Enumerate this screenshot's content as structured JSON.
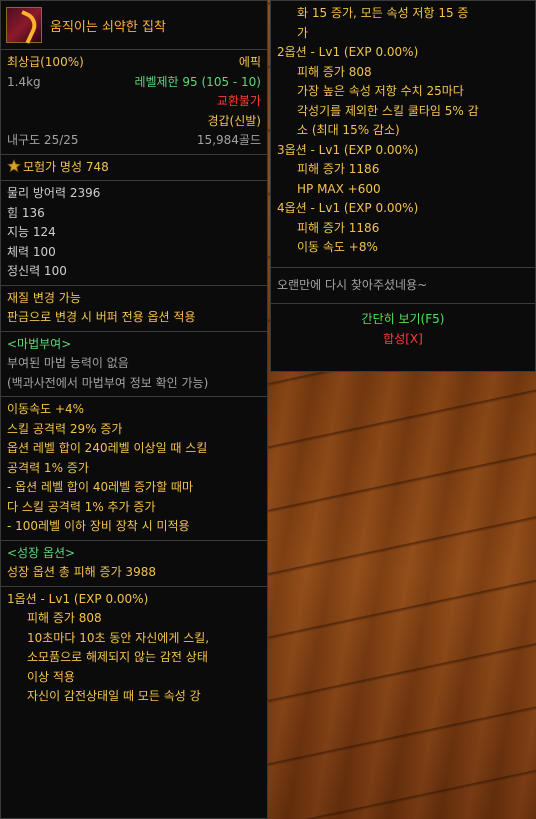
{
  "item": {
    "name": "움직이는 쇠약한 집착",
    "grade": "최상급(100%)",
    "rarity": "에픽",
    "weight": "1.4kg",
    "level_limit": "레벨제한 95 (105 - 10)",
    "trade": "교환불가",
    "armor_type": "경갑(신발)",
    "durability": "내구도 25/25",
    "price": "15,984골드",
    "fame": "모험가 명성 748",
    "stats": [
      "물리 방어력 2396",
      "힘 136",
      "지능 124",
      "체력 100",
      "정신력 100"
    ],
    "material": [
      "재질 변경 가능",
      "판금으로 변경 시 버퍼 전용 옵션 적용"
    ],
    "enchant": {
      "header": "<마법부여>",
      "lines": [
        "부여된 마법 능력이 없음",
        "(백과사전에서 마법부여 정보 확인 가능)"
      ]
    },
    "options": [
      "이동속도 +4%",
      "스킬 공격력 29% 증가",
      "옵션 레벨 합이 240레벨 이상일 때 스킬",
      "공격력 1% 증가",
      "- 옵션 레벨 합이 40레벨 증가할 때마",
      "다 스킬 공격력 1% 추가 증가",
      "- 100레벨 이하 장비 장착 시 미적용"
    ],
    "growth": {
      "header": "<성장 옵션>",
      "total": "성장 옵션 총 피해 증가 3988",
      "opt1_header": "1옵션 - Lv1 (EXP 0.00%)",
      "opt1_lines": [
        "피해 증가 808",
        "10초마다 10초 동안 자신에게 스킬,",
        "소모품으로 해제되지 않는 감전 상태",
        "이상 적용",
        "자신이 감전상태일 때 모든 속성 강"
      ]
    }
  },
  "right": {
    "cont_lines": [
      "화 15 증가, 모든 속성 저항 15 증",
      "가"
    ],
    "opt2_header": "2옵션 - Lv1 (EXP 0.00%)",
    "opt2_lines": [
      "피해 증가 808",
      "가장 높은 속성 저항 수치 25마다",
      "각성기를 제외한 스킬 쿨타임 5% 감",
      "소 (최대 15% 감소)"
    ],
    "opt3_header": "3옵션 - Lv1 (EXP 0.00%)",
    "opt3_lines": [
      "피해 증가 1186",
      "HP MAX +600"
    ],
    "opt4_header": "4옵션 - Lv1 (EXP 0.00%)",
    "opt4_lines": [
      "피해 증가 1186",
      "이동 속도 +8%"
    ],
    "flavor": "오랜만에 다시 찾아주셨네용~",
    "simple_view": "간단히 보기(F5)",
    "synthesis": "합성[X]"
  },
  "colors": {
    "title": "#ffb13b",
    "gold": "#f3c34c",
    "red": "#ff3b3b",
    "green": "#5fd67a",
    "orange": "#ff9a2e"
  }
}
